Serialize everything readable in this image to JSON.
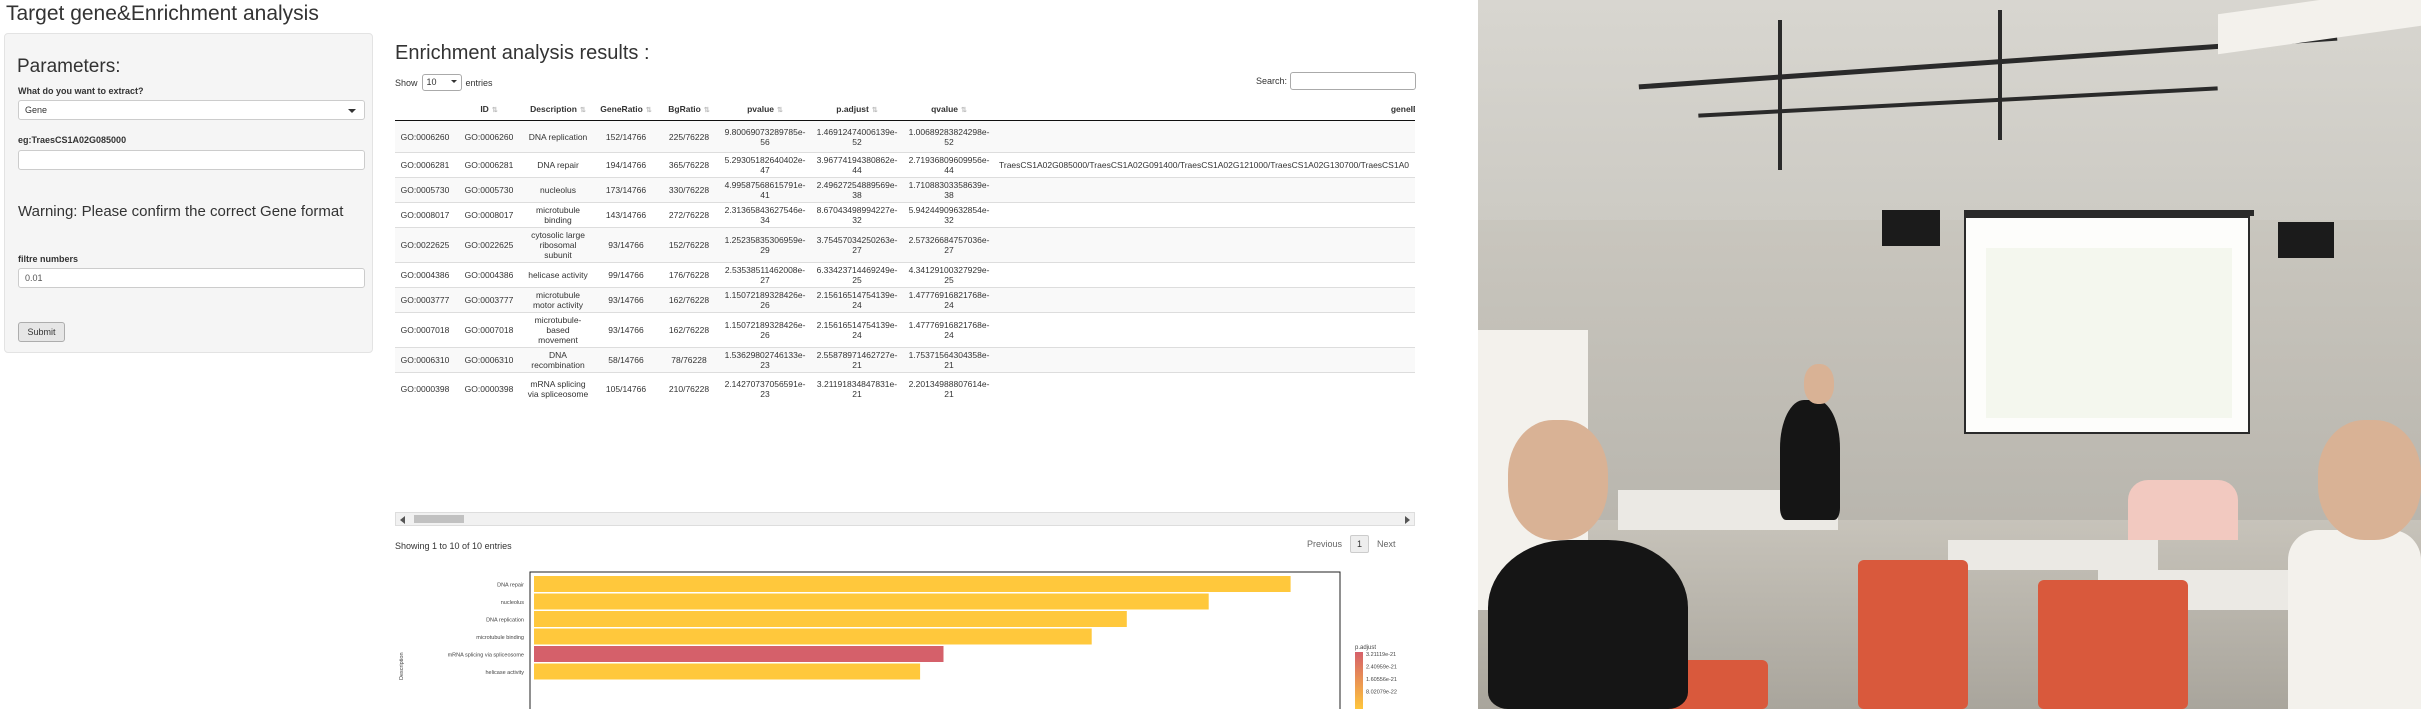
{
  "app": {
    "title": "Target gene&Enrichment analysis"
  },
  "sidebar": {
    "heading": "Parameters:",
    "extract_label": "What do you want to extract?",
    "extract_value": "Gene",
    "gene_label": "eg:TraesCS1A02G085000",
    "gene_value": "",
    "warning": "Warning: Please confirm the correct Gene format",
    "filtre_label": "filtre numbers",
    "filtre_value": "0.01",
    "submit_label": "Submit"
  },
  "results": {
    "title": "Enrichment analysis results :",
    "show_label": "Show",
    "show_value": "10",
    "entries_label": "entries",
    "search_label": "Search:",
    "columns": [
      "",
      "ID",
      "Description",
      "GeneRatio",
      "BgRatio",
      "pvalue",
      "p.adjust",
      "qvalue",
      "geneID"
    ],
    "rows": [
      [
        "GO:0006260",
        "GO:0006260",
        "DNA replication",
        "152/14766",
        "225/76228",
        "9.80069073289785e-56",
        "1.46912474006139e-52",
        "1.00689283824298e-52",
        ""
      ],
      [
        "GO:0006281",
        "GO:0006281",
        "DNA repair",
        "194/14766",
        "365/76228",
        "5.29305182640402e-47",
        "3.96774194380862e-44",
        "2.71936809609956e-44",
        "TraesCS1A02G085000/TraesCS1A02G091400/TraesCS1A02G121000/TraesCS1A02G130700/TraesCS1A0"
      ],
      [
        "GO:0005730",
        "GO:0005730",
        "nucleolus",
        "173/14766",
        "330/76228",
        "4.99587568615791e-41",
        "2.49627254889569e-38",
        "1.71088303358639e-38",
        ""
      ],
      [
        "GO:0008017",
        "GO:0008017",
        "microtubule binding",
        "143/14766",
        "272/76228",
        "2.31365843627546e-34",
        "8.67043498994227e-32",
        "5.94244909632854e-32",
        ""
      ],
      [
        "GO:0022625",
        "GO:0022625",
        "cytosolic large ribosomal subunit",
        "93/14766",
        "152/76228",
        "1.25235835306959e-29",
        "3.75457034250263e-27",
        "2.57326684757036e-27",
        ""
      ],
      [
        "GO:0004386",
        "GO:0004386",
        "helicase activity",
        "99/14766",
        "176/76228",
        "2.53538511462008e-27",
        "6.33423714469249e-25",
        "4.34129100327929e-25",
        ""
      ],
      [
        "GO:0003777",
        "GO:0003777",
        "microtubule motor activity",
        "93/14766",
        "162/76228",
        "1.15072189328426e-26",
        "2.15616514754139e-24",
        "1.47776916821768e-24",
        ""
      ],
      [
        "GO:0007018",
        "GO:0007018",
        "microtubule-based movement",
        "93/14766",
        "162/76228",
        "1.15072189328426e-26",
        "2.15616514754139e-24",
        "1.47776916821768e-24",
        ""
      ],
      [
        "GO:0006310",
        "GO:0006310",
        "DNA recombination",
        "58/14766",
        "78/76228",
        "1.53629802746133e-23",
        "2.55878971462727e-21",
        "1.75371564304358e-21",
        ""
      ],
      [
        "GO:0000398",
        "GO:0000398",
        "mRNA splicing via spliceosome",
        "105/14766",
        "210/76228",
        "2.14270737056591e-23",
        "3.21191834847831e-21",
        "2.20134988807614e-21",
        ""
      ]
    ],
    "info": "Showing 1 to 10 of 10 entries",
    "pager": {
      "previous": "Previous",
      "current": "1",
      "next": "Next"
    }
  },
  "chart_data": {
    "type": "bar",
    "orientation": "horizontal",
    "categories": [
      "DNA repair",
      "nucleolus",
      "DNA replication",
      "microtubule binding",
      "mRNA splicing via spliceosome",
      "helicase activity"
    ],
    "values": [
      194,
      173,
      152,
      143,
      105,
      99
    ],
    "ylabel": "Description",
    "legend": {
      "title": "p.adjust",
      "ticks": [
        "3.21119e-21",
        "2.40959e-21",
        "1.60556e-21",
        "8.02079e-22"
      ],
      "placement": "right"
    },
    "colors": {
      "low_padjust": "#ffc83c",
      "high_padjust": "#d5606a"
    },
    "bar_colors": [
      "#ffc83c",
      "#ffc83c",
      "#ffc83c",
      "#ffc83c",
      "#d5606a",
      "#ffc83c"
    ]
  }
}
